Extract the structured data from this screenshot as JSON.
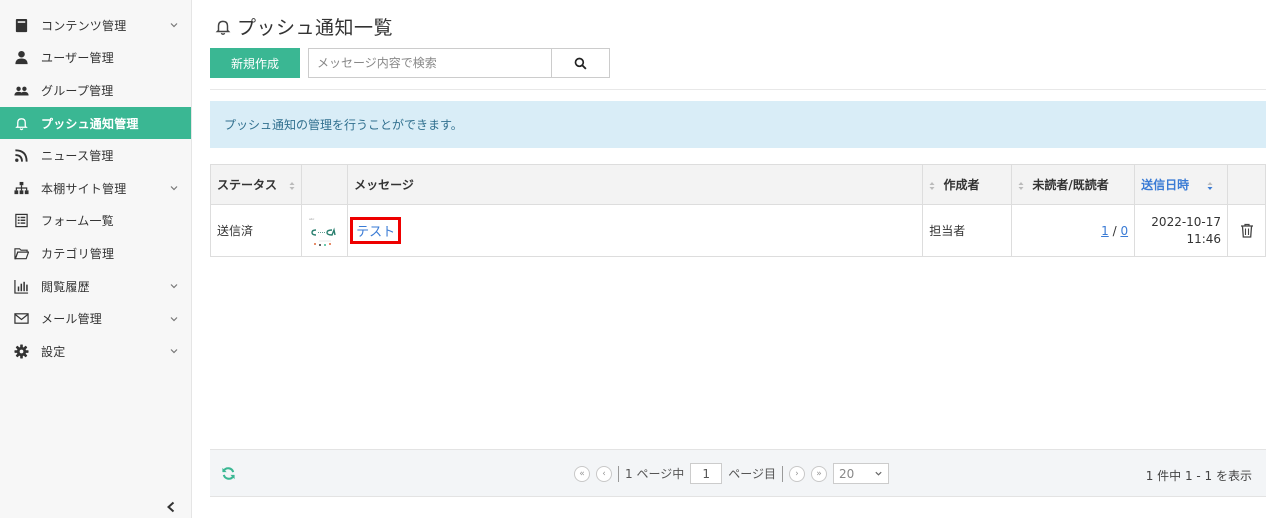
{
  "sidebar": {
    "items": [
      {
        "label": "コンテンツ管理",
        "icon": "book-icon",
        "chevron": true
      },
      {
        "label": "ユーザー管理",
        "icon": "user-icon",
        "chevron": false
      },
      {
        "label": "グループ管理",
        "icon": "users-icon",
        "chevron": false
      },
      {
        "label": "プッシュ通知管理",
        "icon": "bell-icon",
        "chevron": false,
        "active": true
      },
      {
        "label": "ニュース管理",
        "icon": "rss-icon",
        "chevron": false
      },
      {
        "label": "本棚サイト管理",
        "icon": "sitemap-icon",
        "chevron": true
      },
      {
        "label": "フォーム一覧",
        "icon": "form-icon",
        "chevron": false
      },
      {
        "label": "カテゴリ管理",
        "icon": "folder-icon",
        "chevron": false
      },
      {
        "label": "閲覧履歴",
        "icon": "bar-chart-icon",
        "chevron": true
      },
      {
        "label": "メール管理",
        "icon": "envelope-icon",
        "chevron": true
      },
      {
        "label": "設定",
        "icon": "gear-icon",
        "chevron": true
      }
    ],
    "active_color": "#3ab793"
  },
  "page": {
    "title": "プッシュ通知一覧"
  },
  "toolbar": {
    "new_label": "新規作成",
    "search_placeholder": "メッセージ内容で検索"
  },
  "info": {
    "text": "プッシュ通知の管理を行うことができます。"
  },
  "table": {
    "headers": {
      "status": "ステータス",
      "message": "メッセージ",
      "author": "作成者",
      "unread_read": "未読者/既読者",
      "sent_at": "送信日時"
    },
    "rows": [
      {
        "status": "送信済",
        "message": "テスト",
        "author": "担当者",
        "unread": "1",
        "read": "0",
        "date": "2022-10-17",
        "time": "11:46"
      }
    ],
    "slash": "/"
  },
  "pager": {
    "page_prefix": "1 ページ中",
    "page_value": "1",
    "page_suffix": "ページ目",
    "per_page": "20",
    "summary": "1 件中 1 - 1 を表示"
  },
  "colors": {
    "accent": "#3ab793",
    "link": "#3a7bd5",
    "info_bg": "#d9edf7",
    "highlight_border": "#e00000"
  }
}
